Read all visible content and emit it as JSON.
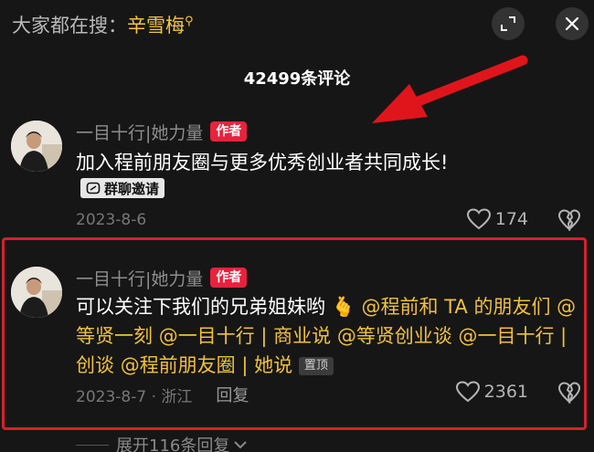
{
  "header": {
    "search_prefix": "大家都在搜：",
    "search_term": "辛雪梅",
    "search_icon": "search-icon",
    "expand_icon": "fullscreen-icon",
    "close_icon": "close-icon"
  },
  "comment_count": "42499条评论",
  "comments": [
    {
      "author": "一目十行|她力量",
      "badge": "作者",
      "text": "加入程前朋友圈与更多优秀创业者共同成长!",
      "pill": "群聊邀请",
      "date": "2023-8-6",
      "likes": "174"
    },
    {
      "author": "一目十行|她力量",
      "badge": "作者",
      "text_line1": "可以关注下我们的兄弟姐妹哟",
      "emoji": "🫰",
      "mention_a": "@程前和 TA 的朋友们",
      "mention_b": "@等贤一刻",
      "mention_c": "@一目十行 | 商业说",
      "mention_d": "@等贤创业谈",
      "mention_e": "@一目十行 | 创谈",
      "mention_f": "@程前朋友圈 | 她说",
      "pinned": "置顶",
      "date": "2023-8-7 · 浙江",
      "reply": "回复",
      "likes": "2361"
    }
  ],
  "expand_replies": "展开116条回复",
  "colors": {
    "background": "#161616",
    "mention": "#f0c040",
    "badge": "#e8223d",
    "highlight_box": "#d8202c",
    "arrow": "#e0151c"
  }
}
